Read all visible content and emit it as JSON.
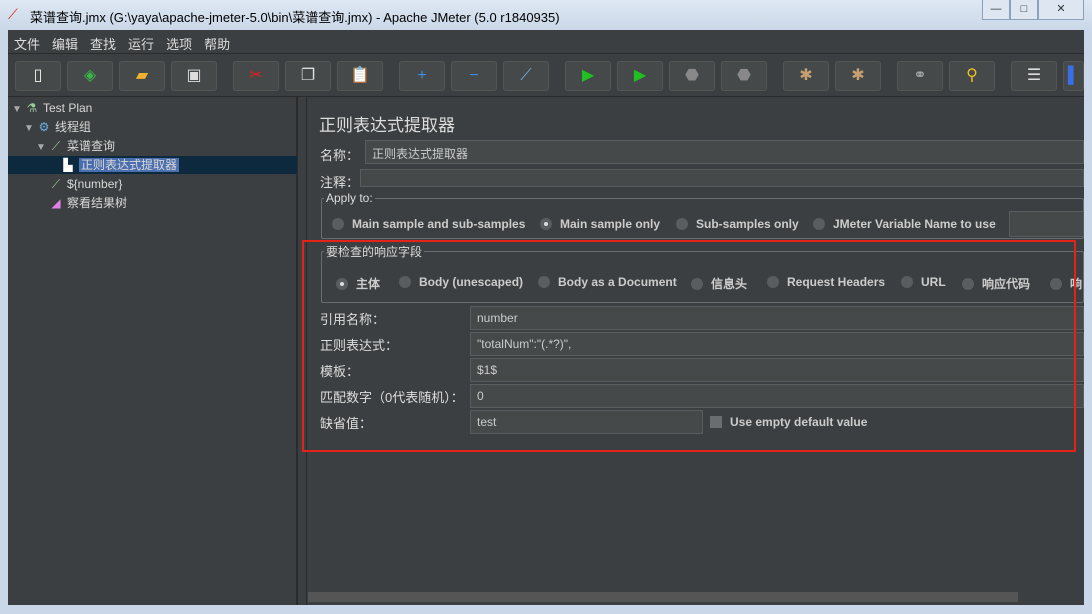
{
  "window": {
    "title": "菜谱查询.jmx (G:\\yaya\\apache-jmeter-5.0\\bin\\菜谱查询.jmx) - Apache JMeter (5.0 r1840935)",
    "minimize": "—",
    "maximize": "□",
    "close": "✕"
  },
  "menu": [
    "文件",
    "编辑",
    "查找",
    "运行",
    "选项",
    "帮助"
  ],
  "toolbar": [
    {
      "icon": "new-icon",
      "glyph": "▯",
      "color": "#f4f4e8"
    },
    {
      "icon": "templates-icon",
      "glyph": "◈",
      "color": "#3bb54a"
    },
    {
      "icon": "open-icon",
      "glyph": "▰",
      "color": "#f0b030"
    },
    {
      "icon": "save-icon",
      "glyph": "▣",
      "color": "#ddd"
    },
    {
      "icon": "cut-icon",
      "glyph": "✂",
      "color": "#e02020"
    },
    {
      "icon": "copy-icon",
      "glyph": "❐",
      "color": "#ddd"
    },
    {
      "icon": "paste-icon",
      "glyph": "📋",
      "color": "#e0a040"
    },
    {
      "icon": "expand-icon",
      "glyph": "+",
      "color": "#3a8ee6"
    },
    {
      "icon": "collapse-icon",
      "glyph": "−",
      "color": "#3a8ee6"
    },
    {
      "icon": "toggle-icon",
      "glyph": "⟋",
      "color": "#6ab0e6"
    },
    {
      "icon": "start-icon",
      "glyph": "▶",
      "color": "#20c020"
    },
    {
      "icon": "start-no-pause-icon",
      "glyph": "▶",
      "color": "#20c020"
    },
    {
      "icon": "stop-icon",
      "glyph": "⬣",
      "color": "#888"
    },
    {
      "icon": "shutdown-icon",
      "glyph": "⬣",
      "color": "#888"
    },
    {
      "icon": "clear-icon",
      "glyph": "✱",
      "color": "#c8a070"
    },
    {
      "icon": "clear-all-icon",
      "glyph": "✱",
      "color": "#c8a070"
    },
    {
      "icon": "search-icon",
      "glyph": "⚭",
      "color": "#aaa"
    },
    {
      "icon": "reset-search-icon",
      "glyph": "⚲",
      "color": "#f0c020"
    },
    {
      "icon": "function-helper-icon",
      "glyph": "☰",
      "color": "#ddd"
    },
    {
      "icon": "help-icon",
      "glyph": "▌",
      "color": "#3a6ee6"
    }
  ],
  "tree": [
    {
      "label": "Test Plan",
      "icon": "test-plan-icon",
      "glyph": "⚗",
      "level": 0,
      "arrow": "▼"
    },
    {
      "label": "线程组",
      "icon": "thread-group-icon",
      "glyph": "⚙",
      "level": 1,
      "arrow": "▼"
    },
    {
      "label": "菜谱查询",
      "icon": "sampler-icon",
      "glyph": "⟋",
      "level": 2,
      "arrow": "▼"
    },
    {
      "label": "正则表达式提取器",
      "icon": "extractor-icon",
      "glyph": "▙",
      "level": 3,
      "arrow": "",
      "selected": true
    },
    {
      "label": "${number}",
      "icon": "sampler-icon",
      "glyph": "⟋",
      "level": 2,
      "arrow": ""
    },
    {
      "label": "察看结果树",
      "icon": "listener-icon",
      "glyph": "◢",
      "level": 2,
      "arrow": ""
    }
  ],
  "panel": {
    "title": "正则表达式提取器",
    "name_label": "名称：",
    "name_value": "正则表达式提取器",
    "comment_label": "注释：",
    "comment_value": "",
    "apply_to": {
      "legend": "Apply to:",
      "options": [
        "Main sample and sub-samples",
        "Main sample only",
        "Sub-samples only",
        "JMeter Variable Name to use"
      ],
      "selected": 1,
      "variable_value": ""
    },
    "field": {
      "legend": "要检查的响应字段",
      "options": [
        "主体",
        "Body (unescaped)",
        "Body as a Document",
        "信息头",
        "Request Headers",
        "URL",
        "响应代码",
        "响"
      ],
      "selected": 0
    },
    "ref_label": "引用名称：",
    "ref_value": "number",
    "regex_label": "正则表达式：",
    "regex_value": "\"totalNum\":\"(.*?)\",",
    "template_label": "模板：",
    "template_value": "$1$",
    "match_label": "匹配数字（0代表随机）：",
    "match_value": "0",
    "default_label": "缺省值：",
    "default_value": "test",
    "empty_default_label": "Use empty default value",
    "empty_default_checked": false
  },
  "colors": {
    "highlight": "#e2231a",
    "selection": "#4b6eaf"
  }
}
